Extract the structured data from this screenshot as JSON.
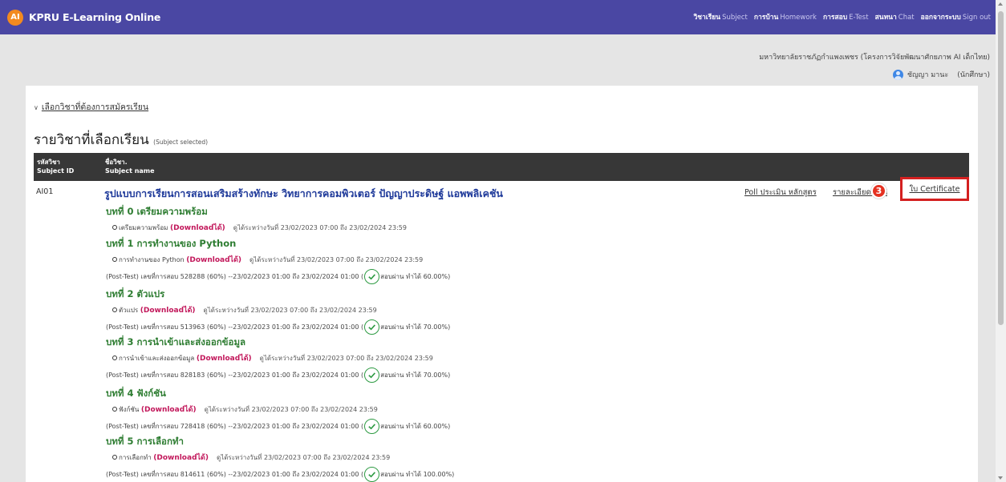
{
  "app": {
    "logo_text": "AI",
    "title": "KPRU E-Learning Online"
  },
  "nav": [
    {
      "th": "วิชาเรียน",
      "en": "Subject"
    },
    {
      "th": "การบ้าน",
      "en": "Homework"
    },
    {
      "th": "การสอบ",
      "en": "E-Test"
    },
    {
      "th": "สนทนา",
      "en": "Chat"
    },
    {
      "th": "ออกจากระบบ",
      "en": "Sign out"
    }
  ],
  "user": {
    "university": "มหาวิทยาลัยราชภัฏกำแพงเพชร (โครงการวิจัยพัฒนาศักยภาพ AI เด็กไทย)",
    "name": "ชัญญา มานะ",
    "role": "(นักศึกษา)"
  },
  "enroll_link": "เลือกวิชาที่ต้องการสมัครเรียน",
  "section": {
    "title": "รายวิชาที่เลือกเรียน",
    "subtitle": "(Subject selected)"
  },
  "table": {
    "col1_th": "รหัสวิชา",
    "col1_en": "Subject ID",
    "col2_th": "ชื่อวิชา.",
    "col2_en": "Subject name"
  },
  "course": {
    "code": "AI01",
    "title": "รูปแบบการเรียนการสอนเสริมสร้างทักษะ วิทยาการคอมพิวเตอร์ ปัญญาประดิษฐ์ แอพพลิเคชัน",
    "poll_link": "Poll ประเมิน หลักสูตร",
    "detail_link": "รายละเอียดรายวิชา",
    "badge": "3",
    "certificate_link": "ใบ Certificate"
  },
  "lessons": [
    {
      "title": "บทที่ 0 เตรียมความพร้อม",
      "item": "เตรียมความพร้อม",
      "download": "(Downloadได้)",
      "period": "ดูได้ระหว่างวันที่ 23/02/2023 07:00 ถึง 23/02/2024 23:59"
    },
    {
      "title": "บทที่ 1 การทำงานของ Python",
      "item": "การทำงานของ Python",
      "download": "(Downloadได้)",
      "period": "ดูได้ระหว่างวันที่ 23/02/2023 07:00 ถึง 23/02/2024 23:59",
      "test": "(Post-Test) เลขที่การสอบ 528288 (60%) --23/02/2023 01:00 ถึง 23/02/2024 01:00 (",
      "result": "สอบผ่าน ทำได้ 60.00%)"
    },
    {
      "title": "บทที่ 2 ตัวแปร",
      "item": "ตัวแปร",
      "download": "(Downloadได้)",
      "period": "ดูได้ระหว่างวันที่ 23/02/2023 07:00 ถึง 23/02/2024 23:59",
      "test": "(Post-Test) เลขที่การสอบ 513963 (60%) --23/02/2023 01:00 ถึง 23/02/2024 01:00 (",
      "result": "สอบผ่าน ทำได้ 70.00%)"
    },
    {
      "title": "บทที่ 3 การนำเข้าและส่งออกข้อมูล",
      "item": "การนำเข้าและส่งออกข้อมูล",
      "download": "(Downloadได้)",
      "period": "ดูได้ระหว่างวันที่ 23/02/2023 07:00 ถึง 23/02/2024 23:59",
      "test": "(Post-Test) เลขที่การสอบ 828183 (60%) --23/02/2023 01:00 ถึง 23/02/2024 01:00 (",
      "result": "สอบผ่าน ทำได้ 70.00%)"
    },
    {
      "title": "บทที่ 4 ฟังก์ชัน",
      "item": "ฟังก์ชัน",
      "download": "(Downloadได้)",
      "period": "ดูได้ระหว่างวันที่ 23/02/2023 07:00 ถึง 23/02/2024 23:59",
      "test": "(Post-Test) เลขที่การสอบ 728418 (60%) --23/02/2023 01:00 ถึง 23/02/2024 01:00 (",
      "result": "สอบผ่าน ทำได้ 60.00%)"
    },
    {
      "title": "บทที่ 5 การเลือกทำ",
      "item": "การเลือกทำ",
      "download": "(Downloadได้)",
      "period": "ดูได้ระหว่างวันที่ 23/02/2023 07:00 ถึง 23/02/2024 23:59",
      "test": "(Post-Test) เลขที่การสอบ 814611 (60%) --23/02/2023 01:00 ถึง 23/02/2024 01:00 (",
      "result": "สอบผ่าน ทำได้ 100.00%)"
    }
  ]
}
